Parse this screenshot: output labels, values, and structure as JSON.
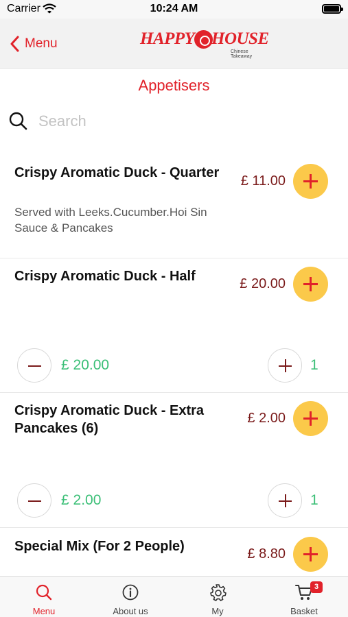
{
  "status_bar": {
    "carrier": "Carrier",
    "time": "10:24 AM"
  },
  "nav": {
    "back_label": "Menu",
    "logo_word_1": "HAPPY",
    "logo_word_2": "HOUSE",
    "logo_tagline": "Chinese Takeaway"
  },
  "page_title": "Appetisers",
  "search": {
    "placeholder": "Search",
    "value": ""
  },
  "items": [
    {
      "name": "Crispy Aromatic Duck - Quarter",
      "description": "Served with Leeks.Cucumber.Hoi Sin Sauce & Pancakes",
      "price": "£ 11.00"
    },
    {
      "name": "Crispy Aromatic Duck - Half",
      "description": "",
      "price": "£ 20.00",
      "quantity": "1",
      "line_total": "£ 20.00"
    },
    {
      "name": "Crispy Aromatic Duck - Extra Pancakes (6)",
      "description": "",
      "price": "£ 2.00",
      "quantity": "1",
      "line_total": "£ 2.00"
    },
    {
      "name": "Special Mix (For 2 People)",
      "description": "",
      "price": "£ 8.80"
    }
  ],
  "tab_bar": {
    "tabs": [
      {
        "label": "Menu",
        "icon": "search-icon",
        "active": true
      },
      {
        "label": "About us",
        "icon": "info-icon",
        "active": false
      },
      {
        "label": "My",
        "icon": "gear-icon",
        "active": false
      },
      {
        "label": "Basket",
        "icon": "cart-icon",
        "active": false,
        "badge": "3"
      }
    ]
  },
  "colors": {
    "accent": "#e1222a",
    "add_button": "#fbc94a",
    "price": "#7a1a1a",
    "quantity": "#3bbf77"
  }
}
